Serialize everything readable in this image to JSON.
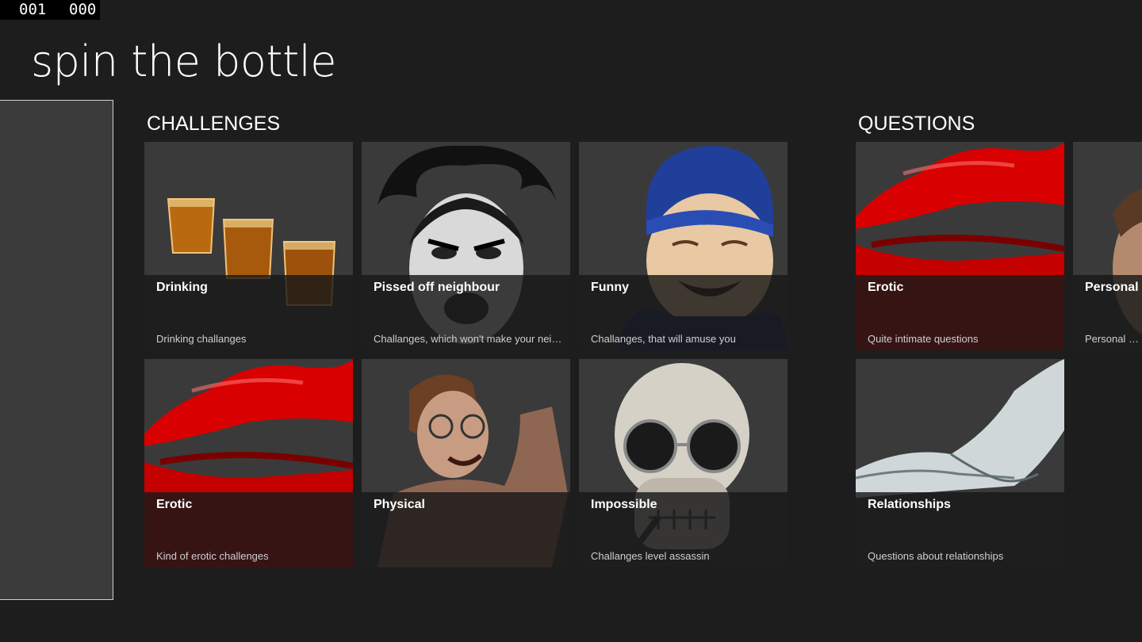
{
  "counters": {
    "left": "001",
    "right": "000"
  },
  "app": {
    "title": "spin the bottle"
  },
  "groups": {
    "challenges": {
      "header": "CHALLENGES",
      "tiles": [
        {
          "title": "Drinking",
          "desc": "Drinking challanges",
          "image": "shot-glasses"
        },
        {
          "title": "Pissed off neighbour",
          "desc": "Challanges, which won't make your neighbour happy",
          "image": "angry-man-face"
        },
        {
          "title": "Funny",
          "desc": "Challanges, that will amuse you",
          "image": "laughing-old-man"
        },
        {
          "title": "Erotic",
          "desc": "Kind of erotic challenges",
          "image": "red-lips"
        },
        {
          "title": "Physical",
          "desc": "",
          "image": "flexing-man"
        },
        {
          "title": "Impossible",
          "desc": "Challanges level assassin",
          "image": "skull-sunglasses"
        }
      ]
    },
    "questions": {
      "header": "QUESTIONS",
      "tiles": [
        {
          "title": "Erotic",
          "desc": "Quite intimate questions",
          "image": "red-lips"
        },
        {
          "title": "Personal",
          "desc": "Personal questions",
          "image": "face-portrait"
        },
        {
          "title": "Relationships",
          "desc": "Questions about relationships",
          "image": "holding-hands"
        }
      ]
    }
  },
  "colors": {
    "background": "#1d1d1d",
    "tile": "#3a3a3a",
    "lips": "#d80000"
  }
}
